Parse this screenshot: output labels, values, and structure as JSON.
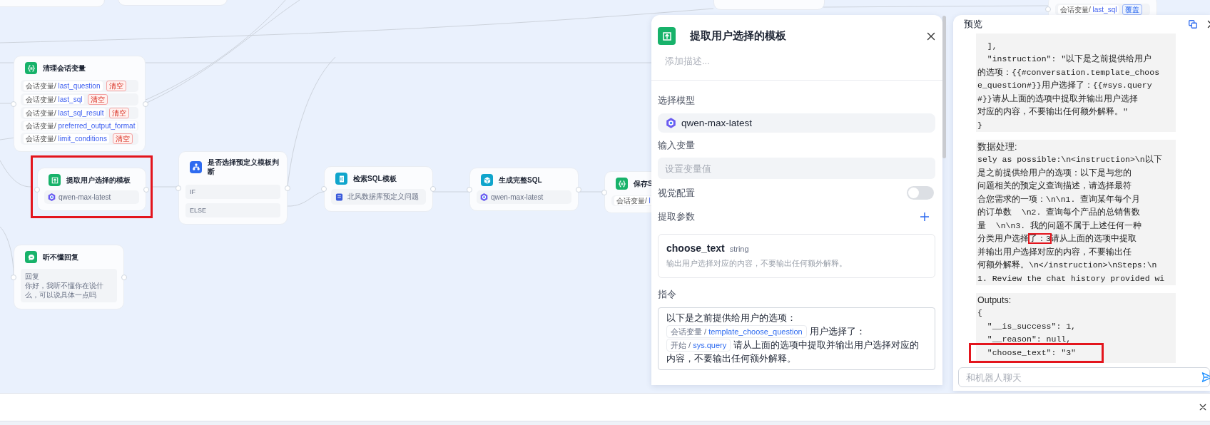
{
  "canvas": {
    "nodes": [
      {
        "kind": "variable",
        "title": "清理会话变量",
        "rows": [
          {
            "label": "会话变量/ ",
            "variable": "last_question",
            "action": {
              "text": "清空",
              "kind": "clear"
            }
          },
          {
            "label": "会话变量/ ",
            "variable": "last_sql",
            "action": {
              "text": "清空",
              "kind": "clear"
            }
          },
          {
            "label": "会话变量/ ",
            "variable": "last_sql_result",
            "action": {
              "text": "清空",
              "kind": "clear"
            }
          },
          {
            "label": "会话变量/ ",
            "variable": "preferred_output_format"
          },
          {
            "label": "会话变量/ ",
            "variable": "limit_conditions",
            "action": {
              "text": "清空",
              "kind": "clear"
            }
          }
        ]
      },
      {
        "kind": "extractor",
        "title": "提取用户选择的模板",
        "model": "qwen-max-latest",
        "highlighted": true
      },
      {
        "kind": "condition",
        "title": "是否选择预定义模板判断",
        "branches": [
          "IF",
          "ELSE"
        ]
      },
      {
        "kind": "answer",
        "title": "听不懂回复",
        "reply_label": "回复",
        "reply": "你好，我听不懂你在说什么，可以说具体一点吗"
      },
      {
        "kind": "knowledge",
        "title": "检索SQL模板",
        "dataset": "北风数据库预定义问题"
      },
      {
        "kind": "llm",
        "title": "生成完整SQL",
        "model": "qwen-max-latest"
      },
      {
        "kind": "variable",
        "title": "保存S",
        "rows": [
          {
            "label": "会话变量/ ",
            "variable": "l"
          }
        ]
      },
      {
        "kind": "variable",
        "rows": [
          {
            "label": "会话变量/ ",
            "variable": "last_sql",
            "action": {
              "text": "覆盖",
              "kind": "overwrite"
            }
          }
        ]
      }
    ]
  },
  "node_panel": {
    "title": "提取用户选择的模板",
    "description_placeholder": "添加描述...",
    "model": {
      "label": "选择模型",
      "value": "qwen-max-latest"
    },
    "input": {
      "label": "输入变量",
      "placeholder": "设置变量值"
    },
    "vision": {
      "label": "视觉配置",
      "on": false
    },
    "params": {
      "label": "提取参数",
      "items": [
        {
          "name": "choose_text",
          "type": "string",
          "description": "输出用户选择对应的内容，不要输出任何额外解释。"
        }
      ]
    },
    "instruction": {
      "label": "指令",
      "segments": [
        {
          "kind": "text",
          "text": "以下是之前提供给用户的选项："
        },
        {
          "kind": "variable",
          "scope": "会话变量 / ",
          "name": "template_choose_question"
        },
        {
          "kind": "text",
          "text": "用户选择了："
        },
        {
          "kind": "variable",
          "scope": "开始 / ",
          "name": "sys.query"
        },
        {
          "kind": "text",
          "text": "请从上面的选项中提取并输出用户选择对应的内容，不要输出任何额外解释。"
        }
      ]
    }
  },
  "preview": {
    "title": "预览",
    "blocks": [
      {
        "lines": [
          "  ],",
          "  \"instruction\": \"以下是之前提供给用户",
          "的选项：{{#conversation.template_choos",
          "e_question#}}用户选择了：{{#sys.query",
          "#}}请从上面的选项中提取并输出用户选择",
          "对应的内容，不要输出任何额外解释。\"",
          "}"
        ]
      },
      {
        "label": "数据处理:",
        "lines": [
          "sely as possible:\\n<instruction>\\n以下",
          "是之前提供给用户的选项：以下是与您的",
          "问题相关的预定义查询描述，请选择最符",
          "合您需求的一项：\\n\\n1. 查询某年每个月",
          "的订单数  \\n2. 查询每个产品的总销售数",
          "量  \\n\\n3. 我的问题不属于上述任何一种",
          {
            "parts": [
              {
                "text": "分类用户选择",
                "highlighted": false
              },
              {
                "text": "了：3",
                "highlighted": true
              },
              {
                "text": "请从上面的选项中提取",
                "highlighted": false
              }
            ]
          },
          "并输出用户选择对应的内容，不要输出任",
          "何额外解释。\\n</instruction>\\nSteps:\\n",
          "1. Review the chat history provided wi"
        ]
      },
      {
        "label": "Outputs:",
        "lines": [
          "{",
          "  \"__is_success\": 1,",
          "  \"__reason\": null,",
          {
            "text": "  \"choose_text\": \"3\"",
            "highlighted": true
          }
        ]
      }
    ],
    "chat_input": {
      "placeholder": "和机器人聊天"
    }
  }
}
